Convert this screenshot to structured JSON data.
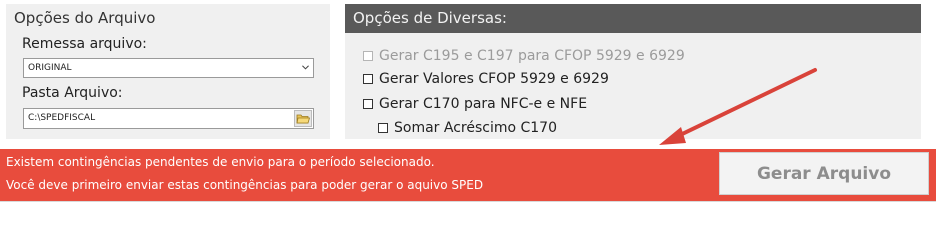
{
  "file_options": {
    "title": "Opções do Arquivo",
    "remessa_label": "Remessa arquivo:",
    "remessa_value": "ORIGINAL",
    "pasta_label": "Pasta Arquivo:",
    "pasta_value": "C:\\SPEDFISCAL"
  },
  "misc_options": {
    "title": "Opções de Diversas:",
    "checkboxes": [
      {
        "label": "Gerar C195 e C197 para CFOP 5929 e 6929",
        "checked": false,
        "enabled": false
      },
      {
        "label": "Gerar Valores  CFOP 5929 e 6929",
        "checked": false,
        "enabled": true
      },
      {
        "label": "Gerar C170 para NFC-e e NFE",
        "checked": false,
        "enabled": true
      },
      {
        "label": "Somar Acréscimo C170",
        "checked": false,
        "enabled": true
      }
    ]
  },
  "alert": {
    "line1": "Existem contingências pendentes de envio para o período selecionado.",
    "line2": "Você deve primeiro enviar estas contingências para poder gerar o aquivo SPED",
    "color": "#e84c3d"
  },
  "generate_button": {
    "label": "Gerar Arquivo",
    "enabled": false
  },
  "icons": {
    "select": "chevron-down-icon",
    "folder": "folder-icon",
    "annotation": "red-arrow-annotation"
  }
}
